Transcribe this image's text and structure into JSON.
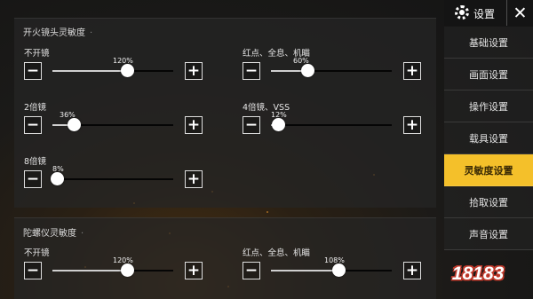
{
  "sections": [
    {
      "title": "开火镜头灵敏度",
      "sliders": [
        {
          "label": "不开镜",
          "value_text": "120%",
          "level": 0.62
        },
        {
          "label": "红点、全息、机瞄",
          "value_text": "60%",
          "level": 0.3
        },
        {
          "label": "2倍镜",
          "value_text": "36%",
          "level": 0.18
        },
        {
          "label": "4倍镜、VSS",
          "value_text": "12%",
          "level": 0.06
        },
        {
          "label": "8倍镜",
          "value_text": "8%",
          "level": 0.04
        }
      ]
    },
    {
      "title": "陀螺仪灵敏度",
      "sliders": [
        {
          "label": "不开镜",
          "value_text": "120%",
          "level": 0.62
        },
        {
          "label": "红点、全息、机瞄",
          "value_text": "108%",
          "level": 0.56
        }
      ]
    }
  ],
  "controls": {
    "minus": "−",
    "plus": "+"
  },
  "sidebar": {
    "title": "设置",
    "close": "✕",
    "items": [
      {
        "label": "基础设置",
        "active": false
      },
      {
        "label": "画面设置",
        "active": false
      },
      {
        "label": "操作设置",
        "active": false
      },
      {
        "label": "载具设置",
        "active": false
      },
      {
        "label": "灵敏度设置",
        "active": true
      },
      {
        "label": "拾取设置",
        "active": false
      },
      {
        "label": "声音设置",
        "active": false
      }
    ]
  },
  "watermark": "18183",
  "colors": {
    "accent": "#f4c02a",
    "fill": "#cfcfcf",
    "track": "#050505"
  },
  "icons": {
    "settings": "gear-icon",
    "close": "close-icon"
  }
}
